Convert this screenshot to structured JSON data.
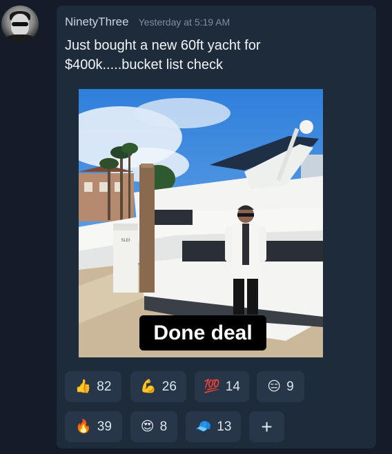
{
  "post": {
    "username": "NinetyThree",
    "timestamp": "Yesterday at 5:19 AM",
    "message": "Just bought a new 60ft yacht for $400k.....bucket list check",
    "image_caption": "Done deal",
    "dock_sign": "SLEI"
  },
  "reactions": [
    {
      "emoji": "👍",
      "icon": "thumbs-up-icon",
      "count": "82"
    },
    {
      "emoji": "💪",
      "icon": "flexed-biceps-icon",
      "count": "26"
    },
    {
      "emoji": "💯",
      "icon": "hundred-points-icon",
      "count": "14"
    },
    {
      "emoji": "😑",
      "icon": "expressionless-face-icon",
      "count": "9"
    },
    {
      "emoji": "🔥",
      "icon": "fire-icon",
      "count": "39"
    },
    {
      "emoji": "😍",
      "icon": "heart-eyes-icon",
      "count": "8"
    },
    {
      "emoji": "🧢",
      "icon": "cap-icon",
      "count": "13"
    }
  ],
  "add_reaction": {
    "label": "+",
    "icon": "plus-icon"
  }
}
